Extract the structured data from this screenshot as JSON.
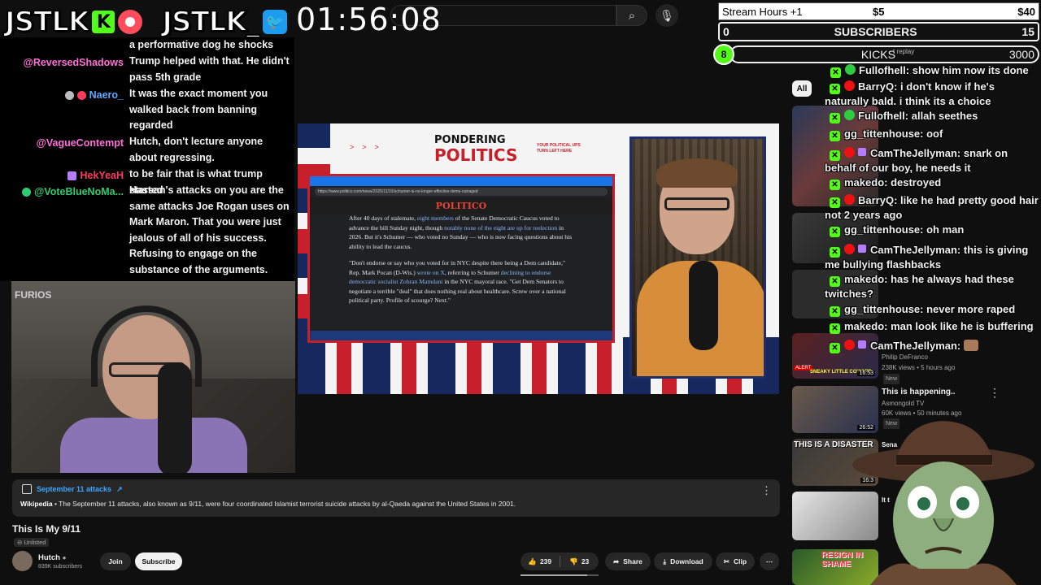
{
  "overlay": {
    "brand_text_1": "JSTLK",
    "kick_letter": "K",
    "brand_text_2": "JSTLK_",
    "clock": "01:56:08"
  },
  "stats": {
    "stream_hours": "Stream Hours +1",
    "mid_price": "$5",
    "right_price": "$40",
    "subs_current": "0",
    "subs_label": "SUBSCRIBERS",
    "subs_goal": "15",
    "kicks_current": "8",
    "kicks_label": "KICKS",
    "kicks_goal": "3000",
    "replay_hint": "t replay"
  },
  "left_chat": [
    {
      "name": "",
      "text": "a performative dog he shocks",
      "name_color": "#ff6fd8"
    },
    {
      "name": "@ReversedShadows",
      "text": "Trump helped with that. He didn't pass 5th grade",
      "name_color": "#ff6fd8"
    },
    {
      "name": "Naero_",
      "text": "It was the exact moment you walked back from banning regarded",
      "name_color": "#5fa8ff"
    },
    {
      "name": "@VagueContempt",
      "text": "Hutch, don't lecture anyone about regressing.",
      "name_color": "#ff6fd8"
    },
    {
      "name": "HekYeaH",
      "text": "to be fair that is what trump started",
      "name_color": "#ff3b5c"
    },
    {
      "name": "@VoteBlueNoMa...",
      "text": "Hassan's attacks on you are the same attacks Joe Rogan uses on Mark Maron. That you were just jealous of all of his success. Refusing to engage on the substance of the arguments.",
      "name_color": "#2ecc71"
    }
  ],
  "webcam": {
    "overlay_text": "FURIOS"
  },
  "video": {
    "show_title_a": "PONDERING",
    "show_title_b": "POLITICS",
    "show_tag": "YOUR POLITICAL UPS TURN LEFT HERE",
    "url": "https://www.politico.com/news/2025/11/10/schumer-is-no-longer-effective-dems-outraged",
    "site_logo": "POLITICO",
    "para1_a": "After 40 days of stalemate, ",
    "para1_link1": "eight members",
    "para1_b": " of the Senate Democratic Caucus voted to advance the bill Sunday night, though ",
    "para1_link2": "notably none of the eight are up for reelection",
    "para1_c": " in 2026. But it's Schumer — who voted no Sunday — who is now facing questions about his ability to lead the caucus.",
    "para2_a": "\"Don't endorse or say who you voted for in NYC despite there being a Dem candidate,\" Rep. Mark Pocan (D-Wis.) ",
    "para2_link1": "wrote on X",
    "para2_b": ", referring to Schumer ",
    "para2_link2": "declining to endorse democratic socialist Zohran Mamdani",
    "para2_c": " in the NYC mayoral race. \"Get Dem Senators to negotiate a terrible \"deal\" that does nothing real about healthcare. Screw over a national political party. Profile of scourge? Next.\""
  },
  "right_chat": [
    {
      "user": "Fullofhell:",
      "text": " show him now its done",
      "badges": [
        "kick",
        "green"
      ]
    },
    {
      "user": "BarryQ:",
      "text": " i don't know if he's naturally bald. i think its a choice",
      "badges": [
        "kick",
        "red"
      ]
    },
    {
      "user": "Fullofhell:",
      "text": " allah seethes",
      "badges": [
        "kick",
        "green"
      ]
    },
    {
      "user": "gg_tittenhouse:",
      "text": " oof",
      "badges": [
        "kick"
      ]
    },
    {
      "user": "CamTheJellyman:",
      "text": " snark on behalf of our boy, he needs it",
      "badges": [
        "kick",
        "red",
        "sub"
      ]
    },
    {
      "user": "makedo:",
      "text": " destroyed",
      "badges": [
        "kick"
      ]
    },
    {
      "user": "BarryQ:",
      "text": " like he had pretty good hair not 2 years ago",
      "badges": [
        "kick",
        "red"
      ]
    },
    {
      "user": "gg_tittenhouse:",
      "text": " oh man",
      "badges": [
        "kick"
      ]
    },
    {
      "user": "CamTheJellyman:",
      "text": " this is giving me bullying flashbacks",
      "badges": [
        "kick",
        "red",
        "sub"
      ]
    },
    {
      "user": "makedo:",
      "text": " has he always had these twitches?",
      "badges": [
        "kick"
      ]
    },
    {
      "user": "gg_tittenhouse:",
      "text": " never more raped",
      "badges": [
        "kick"
      ]
    },
    {
      "user": "makedo:",
      "text": " man look like he is buffering",
      "badges": [
        "kick"
      ]
    },
    {
      "user": "CamTheJellyman:",
      "text": "",
      "badges": [
        "kick",
        "red",
        "sub"
      ]
    }
  ],
  "sidebar": {
    "chip_all": "All",
    "recs": [
      {
        "title": "",
        "channel": "Philip DeFranco",
        "meta": "238K views • 5 hours ago",
        "badge": "New",
        "thumb_text": "SNEAKY LITTLE COWARD",
        "duration": "16:53",
        "alert": "ALERT"
      },
      {
        "title": "This is happening..",
        "channel": "Asmongold TV",
        "meta": "60K views • 50 minutes ago",
        "badge": "New",
        "thumb_text": "",
        "duration": "26:52"
      },
      {
        "title": "Sena Shu",
        "channel": "",
        "meta": "",
        "badge": "",
        "thumb_text": "THIS IS A DISASTER",
        "duration": "16:3"
      },
      {
        "title": "It t",
        "channel": "",
        "meta": "",
        "badge": "",
        "thumb_text": "",
        "duration": ""
      },
      {
        "title": "",
        "channel": "",
        "meta": "",
        "badge": "",
        "thumb_text": "RESIGN IN SHAME",
        "duration": ""
      }
    ]
  },
  "wiki": {
    "title": "September 11 attacks",
    "source": "Wikipedia",
    "text": " • The September 11 attacks, also known as 9/11, were four coordinated Islamist terrorist suicide attacks by al-Qaeda against the United States in 2001."
  },
  "video_info": {
    "title": "This Is My 9/11",
    "visibility": "Unlisted",
    "channel": "Hutch",
    "subscribers": "839K subscribers",
    "join": "Join",
    "subscribe": "Subscribe",
    "likes": "239",
    "dislikes": "23",
    "share": "Share",
    "download": "Download",
    "clip": "Clip",
    "progress_fraction": 0.85
  }
}
